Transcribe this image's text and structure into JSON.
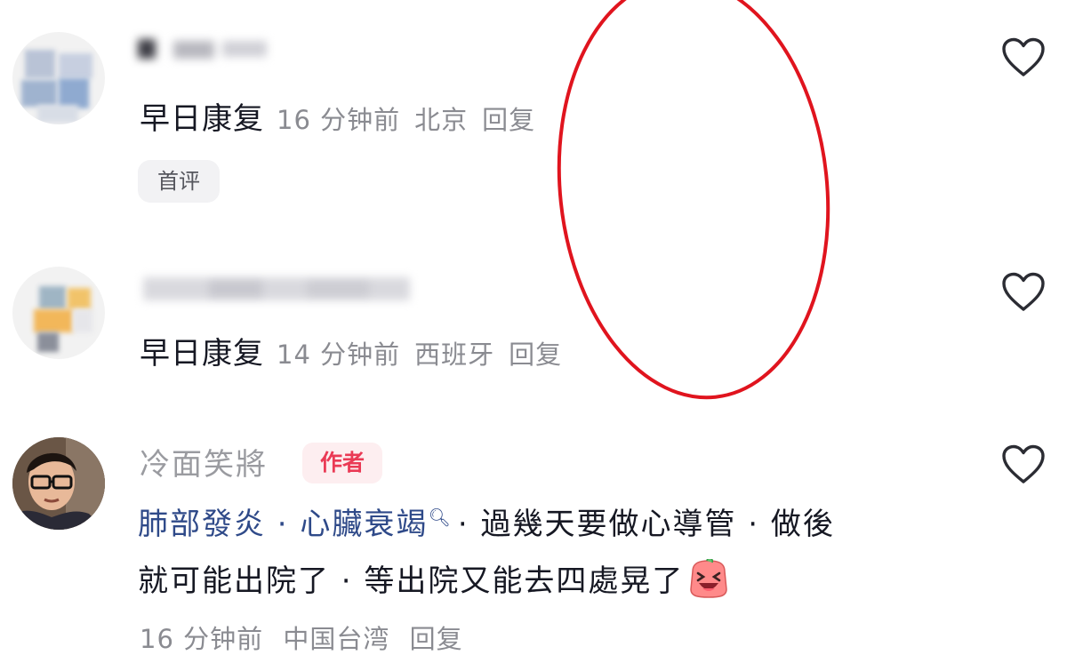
{
  "comments": [
    {
      "content": "早日康复",
      "time": "16 分钟前",
      "location": "北京",
      "reply_label": "回复",
      "badge": "首评",
      "like_icon": "heart-outline-icon"
    },
    {
      "content": "早日康复",
      "time": "14 分钟前",
      "location": "西班牙",
      "reply_label": "回复",
      "like_icon": "heart-outline-icon"
    },
    {
      "username": "冷面笑將",
      "author_badge": "作者",
      "keyword_link": "肺部發炎 · 心臟衰竭",
      "search_icon": "search-icon",
      "text_line1_rest": "· 過幾天要做心導管 · 做後",
      "text_line2": "就可能出院了 · 等出院又能去四處晃了",
      "emoji": "laughing-face-emoji",
      "time": "16 分钟前",
      "location": "中国台湾",
      "reply_label": "回复",
      "like_icon": "heart-outline-icon"
    }
  ],
  "colors": {
    "annotation_red": "#e0141e",
    "link_blue": "#2f4a89",
    "author_badge_red": "#ea3a55",
    "meta_gray": "#8a8b91"
  }
}
